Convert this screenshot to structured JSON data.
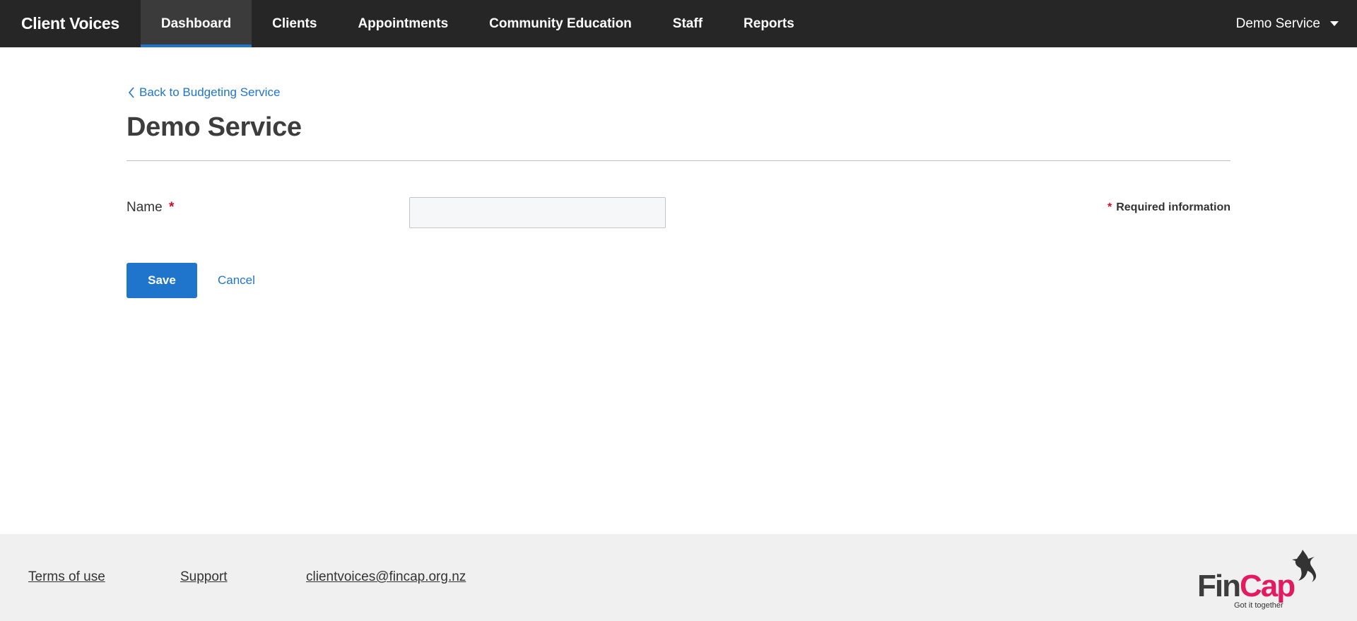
{
  "app": {
    "brand": "Client Voices"
  },
  "nav": {
    "items": [
      {
        "label": "Dashboard",
        "active": true
      },
      {
        "label": "Clients",
        "active": false
      },
      {
        "label": "Appointments",
        "active": false
      },
      {
        "label": "Community Education",
        "active": false
      },
      {
        "label": "Staff",
        "active": false
      },
      {
        "label": "Reports",
        "active": false
      }
    ],
    "account_label": "Demo Service",
    "account_icon": "caret-down-icon"
  },
  "page": {
    "back_link": "Back to Budgeting Service",
    "back_icon": "chevron-left-icon",
    "title": "Demo Service"
  },
  "form": {
    "name_label": "Name",
    "required_star": "*",
    "name_value": "",
    "name_placeholder": "",
    "required_note": "Required information",
    "save_label": "Save",
    "cancel_label": "Cancel"
  },
  "footer": {
    "terms_label": "Terms of use",
    "support_label": "Support",
    "email_label": "clientvoices@fincap.org.nz",
    "logo_main": "FinCap",
    "logo_tagline": "Got it together"
  },
  "colors": {
    "nav_background": "#262626",
    "accent": "#1f75cb",
    "required": "#c8102e",
    "footer_background": "#f0f0f0",
    "logo_pink": "#e5195f"
  }
}
